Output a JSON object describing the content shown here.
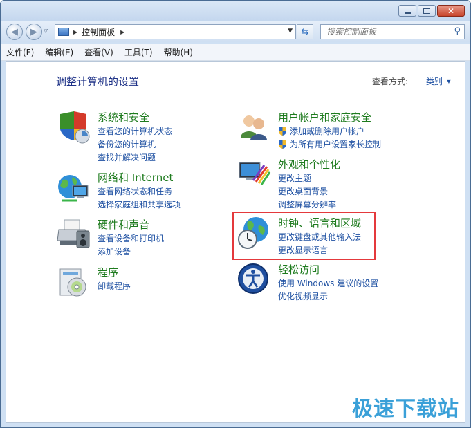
{
  "address": {
    "path": "控制面板"
  },
  "search": {
    "placeholder": "搜索控制面板"
  },
  "menu": [
    "文件(F)",
    "编辑(E)",
    "查看(V)",
    "工具(T)",
    "帮助(H)"
  ],
  "page": {
    "title": "调整计算机的设置",
    "view_by_label": "查看方式:",
    "view_by_value": "类别"
  },
  "categories": [
    {
      "title": "系统和安全",
      "links": [
        "查看您的计算机状态",
        "备份您的计算机",
        "查找并解决问题"
      ]
    },
    {
      "title": "网络和 Internet",
      "links": [
        "查看网络状态和任务",
        "选择家庭组和共享选项"
      ]
    },
    {
      "title": "硬件和声音",
      "links": [
        "查看设备和打印机",
        "添加设备"
      ]
    },
    {
      "title": "程序",
      "links": [
        "卸载程序"
      ]
    },
    {
      "title": "用户帐户和家庭安全",
      "links": [
        "添加或删除用户帐户",
        "为所有用户设置家长控制"
      ]
    },
    {
      "title": "外观和个性化",
      "links": [
        "更改主题",
        "更改桌面背景",
        "调整屏幕分辨率"
      ]
    },
    {
      "title": "时钟、语言和区域",
      "links": [
        "更改键盘或其他输入法",
        "更改显示语言"
      ]
    },
    {
      "title": "轻松访问",
      "links": [
        "使用 Windows 建议的设置",
        "优化视频显示"
      ]
    }
  ],
  "watermark": "极速下载站",
  "colors": {
    "category_title": "#1e7b1e",
    "link": "#1e50a2",
    "heading": "#1e3287",
    "highlight": "#e4393c"
  }
}
